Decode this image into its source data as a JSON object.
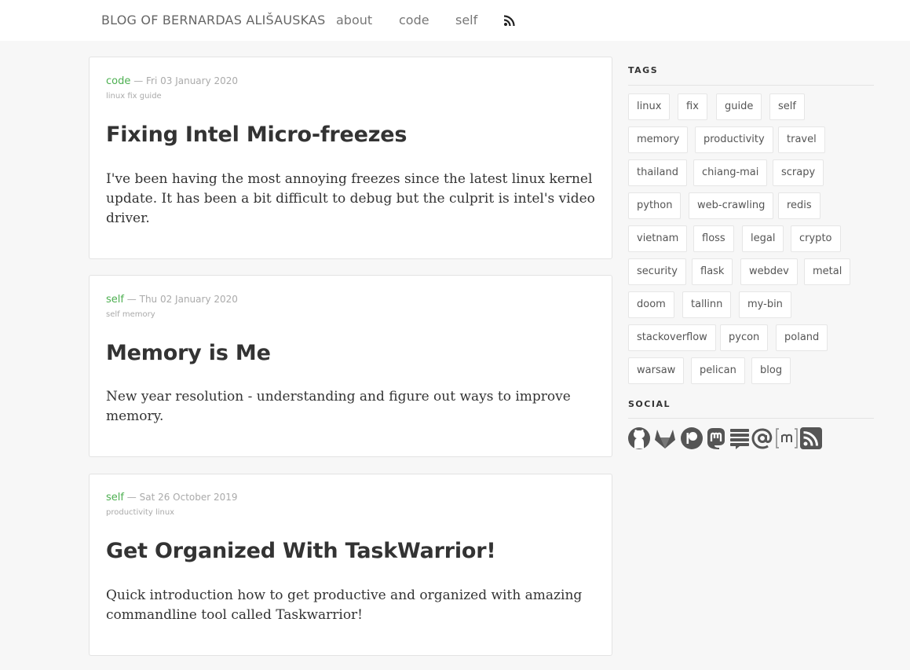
{
  "header": {
    "brand": "BLOG OF BERNARDAS ALIŠAUSKAS",
    "nav": [
      "about",
      "code",
      "self"
    ],
    "rss_icon": "rss-icon"
  },
  "posts": [
    {
      "category": "code",
      "date": "— Fri 03 January 2020",
      "tags": "linux fix guide",
      "title": "Fixing Intel Micro-freezes",
      "summary": "I've been having the most annoying freezes since the latest linux kernel update. It has been a bit difficult to debug but the culprit is intel's video driver."
    },
    {
      "category": "self",
      "date": "— Thu 02 January 2020",
      "tags": "self memory",
      "title": "Memory is Me",
      "summary": "New year resolution - understanding and figure out ways to improve memory."
    },
    {
      "category": "self",
      "date": "— Sat 26 October 2019",
      "tags": "productivity linux",
      "title": "Get Organized With TaskWarrior!",
      "summary": "Quick introduction how to get productive and organized with amazing commandline tool called Taskwarrior!"
    }
  ],
  "sidebar": {
    "tags_heading": "TAGS",
    "tags": [
      "linux",
      "fix",
      "guide",
      "self",
      "memory",
      "productivity",
      "travel",
      "thailand",
      "chiang-mai",
      "scrapy",
      "python",
      "web-crawling",
      "redis",
      "vietnam",
      "floss",
      "legal",
      "crypto",
      "security",
      "flask",
      "webdev",
      "metal",
      "doom",
      "tallinn",
      "my-bin",
      "stackoverflow",
      "pycon",
      "poland",
      "warsaw",
      "pelican",
      "blog"
    ],
    "social_heading": "SOCIAL",
    "social_icons": [
      "github-icon",
      "gitlab-icon",
      "patreon-icon",
      "mastodon-icon",
      "blog-icon",
      "email-icon",
      "matrix-icon",
      "rss-icon"
    ]
  },
  "colors": {
    "accent": "#4caf50",
    "background": "#f7f7f7",
    "icon": "#555555"
  }
}
